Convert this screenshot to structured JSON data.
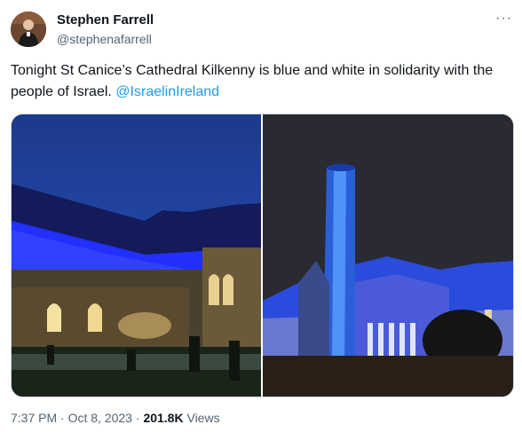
{
  "author": {
    "name": "Stephen Farrell",
    "handle": "@stephenafarrell"
  },
  "tweet": {
    "text": "Tonight St Canice’s Cathedral Kilkenny is blue and white in solidarity with the people of Israel. ",
    "mention": "@IsraelinIreland"
  },
  "menu": {
    "more_label": "···"
  },
  "meta": {
    "time": "7:37 PM",
    "separator1": " · ",
    "date": "Oct 8, 2023",
    "separator2": " · ",
    "views_count": "201.8K",
    "views_label": " Views"
  },
  "colors": {
    "link": "#1d9bf0",
    "secondary_text": "#536471",
    "cathedral_blue": "#1a2cff"
  }
}
